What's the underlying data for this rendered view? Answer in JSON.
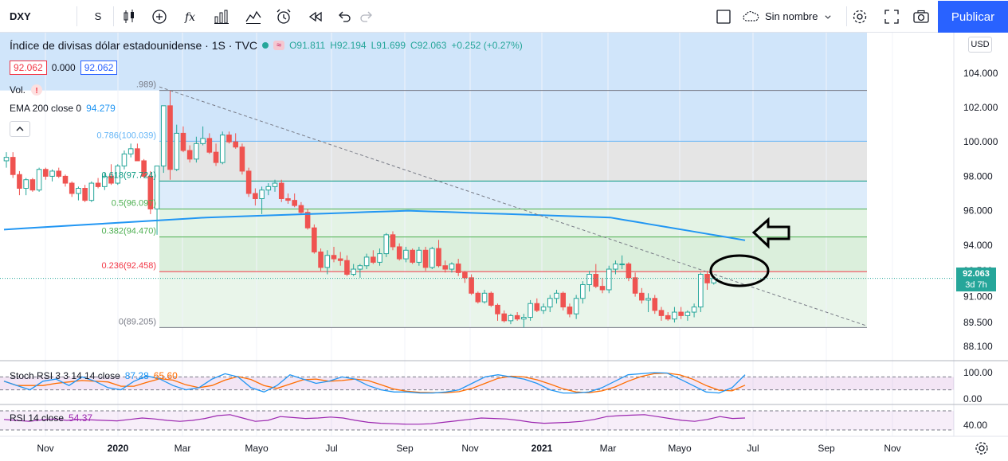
{
  "toolbar": {
    "symbol": "DXY",
    "interval": "S",
    "layout_name": "Sin nombre",
    "publish_label": "Publicar"
  },
  "legend": {
    "title": "Índice de divisas dólar estadounidense · 1S · TVC",
    "ohlc": {
      "o": "O91.811",
      "h": "H92.194",
      "l": "L91.699",
      "c": "C92.063",
      "change": "+0.252 (+0.27%)"
    },
    "bid": "92.062",
    "spread": "0.000",
    "ask": "92.062",
    "vol_label": "Vol.",
    "ema_label": "EMA 200 close 0",
    "ema_value": "94.279",
    "wave_badge": "≈"
  },
  "fib_labels": [
    {
      "text": ".989)",
      "level": 102.989
    },
    {
      "text": "0.786(100.039)",
      "level": 100.039
    },
    {
      "text": "0.618(97.724)",
      "level": 97.724
    },
    {
      "text": "0.5(96.097)",
      "level": 96.097
    },
    {
      "text": "0.382(94.470)",
      "level": 94.47
    },
    {
      "text": "0.236(92.458)",
      "level": 92.458
    },
    {
      "text": "0(89.205)",
      "level": 89.205
    }
  ],
  "current_price": {
    "value": "92.063",
    "countdown": "3d 7h"
  },
  "currency": "USD",
  "indicators": {
    "stoch": {
      "label": "Stoch RSI 3 3 14 14 close",
      "k": "87.28",
      "d": "65.60",
      "k_color": "#2196f3",
      "d_color": "#ff6d00"
    },
    "rsi": {
      "label": "RSI 14 close",
      "value": "54.37",
      "color": "#9c27b0"
    }
  },
  "colors": {
    "up": "#26a69a",
    "down": "#ef5350",
    "ema": "#2196f3",
    "accent": "#2962ff"
  },
  "chart_data": {
    "type": "candlestick",
    "symbol": "DXY",
    "timeframe": "1S",
    "y_axis_labels": [
      "104.000",
      "102.000",
      "100.000",
      "98.000",
      "96.000",
      "94.000",
      "92.500",
      "91.000",
      "89.500",
      "88.100"
    ],
    "x_axis_labels": [
      "Nov",
      "2020",
      "Mar",
      "Mayo",
      "Jul",
      "Sep",
      "Nov",
      "2021",
      "Mar",
      "Mayo",
      "Jul",
      "Sep",
      "Nov"
    ],
    "stoch_axis_labels": [
      "100.00",
      "0.00"
    ],
    "rsi_axis_labels": [
      "40.00"
    ],
    "candles": [
      [
        98.9,
        99.4,
        98.5,
        99.1
      ],
      [
        99.1,
        99.4,
        97.9,
        98.1
      ],
      [
        98.1,
        98.3,
        96.9,
        97.3
      ],
      [
        97.3,
        97.9,
        96.9,
        97.8
      ],
      [
        97.8,
        97.9,
        97.1,
        97.2
      ],
      [
        97.2,
        98.5,
        97.1,
        98.4
      ],
      [
        98.4,
        98.5,
        97.8,
        98.0
      ],
      [
        98.0,
        98.4,
        97.7,
        98.3
      ],
      [
        98.3,
        98.5,
        97.9,
        98.0
      ],
      [
        98.0,
        98.1,
        97.4,
        97.6
      ],
      [
        97.6,
        97.7,
        96.8,
        97.0
      ],
      [
        97.0,
        97.4,
        96.6,
        97.3
      ],
      [
        97.3,
        97.5,
        96.5,
        96.6
      ],
      [
        96.6,
        97.7,
        96.5,
        97.6
      ],
      [
        97.6,
        97.9,
        97.3,
        97.4
      ],
      [
        97.4,
        98.2,
        97.2,
        98.0
      ],
      [
        98.0,
        98.7,
        97.5,
        97.6
      ],
      [
        97.6,
        98.7,
        97.5,
        98.6
      ],
      [
        98.6,
        99.5,
        98.4,
        99.3
      ],
      [
        99.3,
        99.9,
        99.1,
        99.6
      ],
      [
        99.6,
        99.9,
        98.9,
        98.9
      ],
      [
        98.9,
        99.0,
        97.9,
        98.0
      ],
      [
        98.0,
        98.3,
        95.8,
        96.1
      ],
      [
        96.1,
        98.6,
        94.6,
        98.6
      ],
      [
        98.6,
        102.1,
        98.2,
        102.1
      ],
      [
        102.1,
        103.0,
        97.8,
        98.4
      ],
      [
        98.4,
        101.0,
        98.3,
        100.5
      ],
      [
        100.5,
        100.9,
        99.4,
        99.5
      ],
      [
        99.5,
        99.8,
        98.8,
        99.0
      ],
      [
        99.0,
        100.3,
        98.8,
        99.9
      ],
      [
        99.9,
        100.9,
        99.8,
        100.2
      ],
      [
        100.2,
        100.5,
        99.3,
        99.4
      ],
      [
        99.4,
        99.9,
        98.6,
        98.8
      ],
      [
        98.8,
        100.6,
        98.7,
        100.4
      ],
      [
        100.4,
        100.6,
        99.9,
        100.0
      ],
      [
        100.0,
        100.5,
        99.6,
        99.7
      ],
      [
        99.7,
        99.9,
        98.1,
        98.3
      ],
      [
        98.3,
        98.5,
        96.8,
        97.0
      ],
      [
        97.0,
        97.3,
        96.3,
        96.7
      ],
      [
        96.7,
        97.4,
        95.8,
        97.2
      ],
      [
        97.2,
        97.6,
        96.9,
        97.4
      ],
      [
        97.4,
        97.8,
        97.1,
        97.6
      ],
      [
        97.6,
        97.8,
        96.5,
        96.7
      ],
      [
        96.7,
        97.0,
        96.4,
        96.6
      ],
      [
        96.6,
        97.0,
        96.2,
        96.3
      ],
      [
        96.3,
        96.5,
        95.8,
        95.9
      ],
      [
        95.9,
        96.1,
        94.9,
        95.0
      ],
      [
        95.0,
        95.2,
        93.5,
        93.6
      ],
      [
        93.6,
        93.8,
        92.5,
        92.7
      ],
      [
        92.7,
        93.7,
        92.3,
        93.4
      ],
      [
        93.4,
        93.9,
        93.0,
        93.2
      ],
      [
        93.2,
        93.6,
        92.8,
        93.1
      ],
      [
        93.1,
        93.4,
        92.2,
        92.3
      ],
      [
        92.3,
        92.9,
        92.2,
        92.6
      ],
      [
        92.6,
        92.9,
        92.1,
        92.8
      ],
      [
        92.8,
        93.5,
        92.6,
        93.3
      ],
      [
        93.3,
        93.7,
        92.9,
        93.0
      ],
      [
        93.0,
        93.8,
        92.8,
        93.5
      ],
      [
        93.5,
        94.7,
        93.3,
        94.6
      ],
      [
        94.6,
        94.8,
        93.7,
        93.9
      ],
      [
        93.9,
        94.1,
        93.1,
        93.2
      ],
      [
        93.2,
        93.9,
        93.0,
        93.7
      ],
      [
        93.7,
        93.8,
        92.9,
        93.0
      ],
      [
        93.0,
        93.9,
        92.8,
        93.7
      ],
      [
        93.7,
        93.9,
        92.5,
        92.7
      ],
      [
        92.7,
        93.9,
        92.6,
        93.8
      ],
      [
        93.8,
        94.3,
        92.7,
        92.8
      ],
      [
        92.8,
        93.1,
        92.4,
        92.6
      ],
      [
        92.6,
        93.0,
        92.4,
        92.9
      ],
      [
        92.9,
        93.2,
        92.2,
        92.4
      ],
      [
        92.4,
        92.5,
        91.8,
        92.1
      ],
      [
        92.1,
        92.3,
        91.1,
        91.2
      ],
      [
        91.2,
        91.3,
        90.6,
        90.7
      ],
      [
        90.7,
        91.4,
        90.6,
        91.2
      ],
      [
        91.2,
        91.3,
        90.4,
        90.5
      ],
      [
        90.5,
        90.6,
        89.6,
        90.0
      ],
      [
        90.0,
        90.2,
        89.5,
        89.6
      ],
      [
        89.6,
        90.0,
        89.4,
        89.9
      ],
      [
        89.9,
        90.1,
        89.6,
        89.7
      ],
      [
        89.7,
        90.0,
        89.2,
        89.8
      ],
      [
        89.8,
        90.8,
        89.6,
        90.6
      ],
      [
        90.6,
        90.9,
        90.1,
        90.2
      ],
      [
        90.2,
        90.6,
        90.0,
        90.4
      ],
      [
        90.4,
        91.1,
        90.1,
        90.9
      ],
      [
        90.9,
        91.4,
        90.6,
        91.2
      ],
      [
        91.2,
        91.3,
        90.2,
        90.4
      ],
      [
        90.4,
        90.6,
        89.8,
        90.0
      ],
      [
        90.0,
        91.1,
        89.7,
        90.9
      ],
      [
        90.9,
        91.9,
        90.6,
        91.7
      ],
      [
        91.7,
        92.5,
        91.3,
        92.3
      ],
      [
        92.3,
        92.9,
        91.5,
        91.6
      ],
      [
        91.6,
        92.1,
        91.2,
        91.4
      ],
      [
        91.4,
        92.8,
        91.2,
        92.6
      ],
      [
        92.6,
        93.1,
        92.3,
        92.9
      ],
      [
        92.9,
        93.4,
        92.6,
        92.9
      ],
      [
        92.9,
        93.0,
        91.9,
        92.1
      ],
      [
        92.1,
        92.4,
        91.0,
        91.2
      ],
      [
        91.2,
        91.5,
        90.6,
        90.8
      ],
      [
        90.8,
        91.2,
        90.1,
        90.9
      ],
      [
        90.9,
        91.1,
        90.0,
        90.2
      ],
      [
        90.2,
        90.4,
        89.6,
        89.9
      ],
      [
        89.9,
        90.1,
        89.6,
        89.7
      ],
      [
        89.7,
        90.4,
        89.5,
        90.1
      ],
      [
        90.1,
        90.4,
        89.7,
        89.9
      ],
      [
        89.9,
        90.2,
        89.6,
        90.1
      ],
      [
        90.1,
        90.6,
        89.8,
        90.4
      ],
      [
        90.4,
        92.4,
        90.1,
        92.3
      ],
      [
        92.3,
        92.5,
        91.4,
        91.8
      ],
      [
        91.8,
        92.2,
        91.7,
        92.06
      ]
    ],
    "ema200": [
      [
        0,
        94.9
      ],
      [
        30,
        95.6
      ],
      [
        60,
        96.0
      ],
      [
        90,
        95.6
      ],
      [
        110,
        94.28
      ]
    ],
    "fib_levels": [
      102.989,
      100.039,
      97.724,
      96.097,
      94.47,
      92.458,
      89.205
    ],
    "trendline": {
      "from": [
        18,
        103.2
      ],
      "to": [
        130,
        89.3
      ]
    }
  }
}
